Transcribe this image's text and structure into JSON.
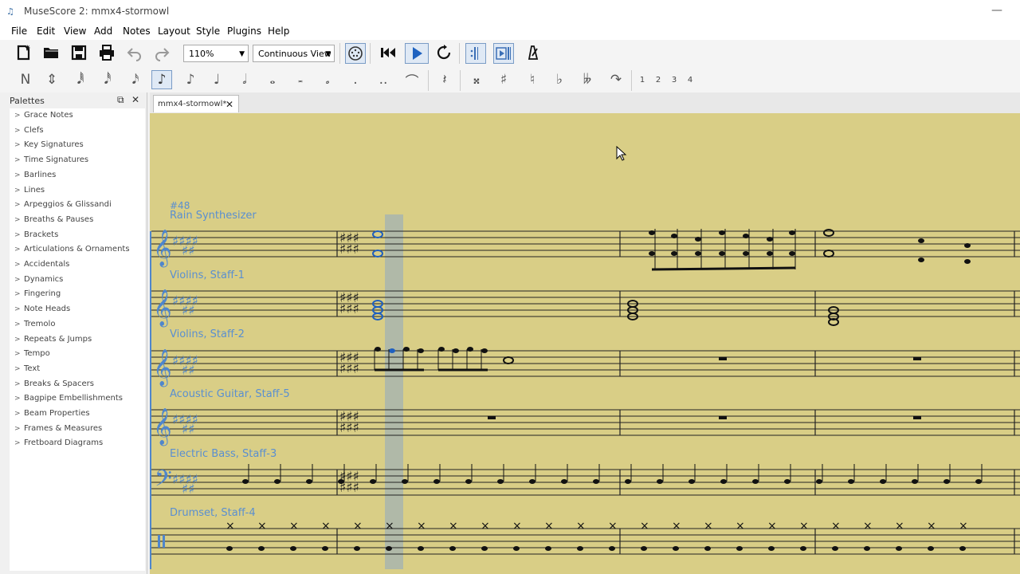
{
  "window": {
    "title": "MuseScore 2: mmx4-stormowl",
    "minimize": "—"
  },
  "menu": [
    "File",
    "Edit",
    "View",
    "Add",
    "Notes",
    "Layout",
    "Style",
    "Plugins",
    "Help"
  ],
  "toolbar": {
    "zoom": "110%",
    "view_mode": "Continuous View"
  },
  "note_input": {
    "voices": [
      "1",
      "2",
      "3",
      "4"
    ]
  },
  "palettes": {
    "title": "Palettes",
    "items": [
      "Grace Notes",
      "Clefs",
      "Key Signatures",
      "Time Signatures",
      "Barlines",
      "Lines",
      "Arpeggios & Glissandi",
      "Breaths & Pauses",
      "Brackets",
      "Articulations & Ornaments",
      "Accidentals",
      "Dynamics",
      "Fingering",
      "Note Heads",
      "Tremolo",
      "Repeats & Jumps",
      "Tempo",
      "Text",
      "Breaks & Spacers",
      "Bagpipe Embellishments",
      "Beam Properties",
      "Frames & Measures",
      "Fretboard Diagrams"
    ]
  },
  "tab": {
    "label": "mmx4-stormowl*",
    "close": "✕"
  },
  "score": {
    "rehearsal": "#48",
    "instruments": [
      "Rain Synthesizer",
      "Violins, Staff-1",
      "Violins, Staff-2",
      "Acoustic Guitar, Staff-5",
      "Electric Bass, Staff-3",
      "Drumset, Staff-4"
    ]
  }
}
